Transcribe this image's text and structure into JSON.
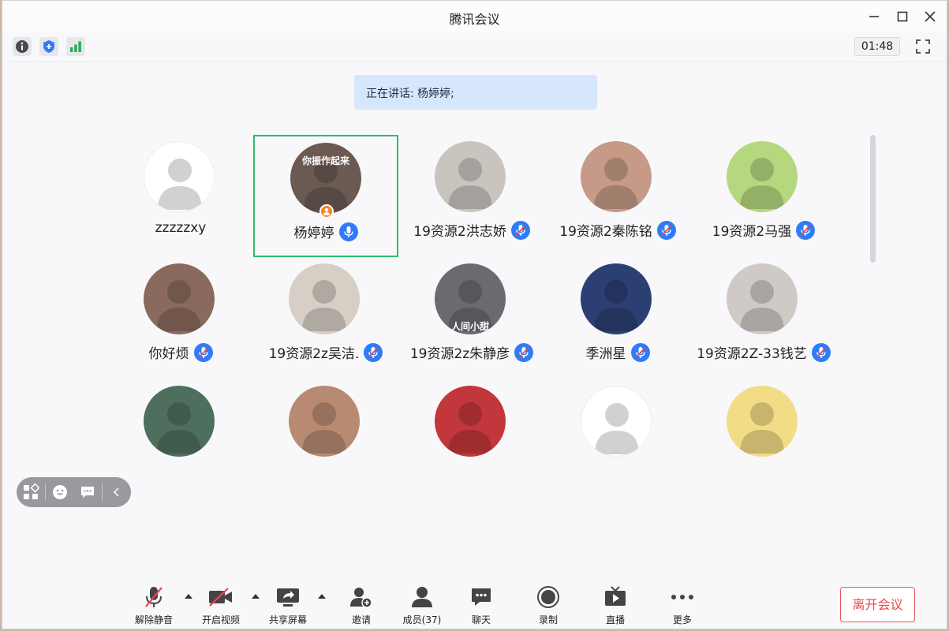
{
  "window": {
    "title": "腾讯会议"
  },
  "infobar": {
    "icons": [
      "info-icon",
      "shield-icon",
      "signal-icon"
    ],
    "timer": "01:48"
  },
  "speaking": {
    "text": "正在讲话: 杨婷婷;"
  },
  "participants": [
    {
      "name": "zzzzzxy",
      "mic": false,
      "avatar_color": "#ffffff"
    },
    {
      "name": "杨婷婷",
      "mic": true,
      "mic_active": true,
      "host": true,
      "avatar_color": "#6b5a52",
      "avatar_caption": "你振作起来"
    },
    {
      "name": "19资源2洪志娇",
      "mic": true,
      "avatar_color": "#c9c4bd"
    },
    {
      "name": "19资源2秦陈铭",
      "mic": true,
      "avatar_color": "#c69a86"
    },
    {
      "name": "19资源2马强",
      "mic": true,
      "avatar_color": "#b5d77e"
    },
    {
      "name": "你好烦",
      "mic": true,
      "avatar_color": "#8a6a5c"
    },
    {
      "name": "19资源2z吴洁.",
      "mic": true,
      "avatar_color": "#d7cfc6"
    },
    {
      "name": "19资源2z朱静彦",
      "mic": true,
      "avatar_color": "#6c6a6f",
      "avatar_caption": "人间小甜"
    },
    {
      "name": "季洲星",
      "mic": true,
      "avatar_color": "#2b3f73"
    },
    {
      "name": "19资源2Z-33钱艺",
      "mic": true,
      "avatar_color": "#cfcac6"
    },
    {
      "name": "",
      "mic": false,
      "avatar_color": "#4e6f5e"
    },
    {
      "name": "",
      "mic": false,
      "avatar_color": "#b88a72"
    },
    {
      "name": "",
      "mic": false,
      "avatar_color": "#c2373b"
    },
    {
      "name": "",
      "mic": false,
      "avatar_color": "#ffffff"
    },
    {
      "name": "",
      "mic": false,
      "avatar_color": "#f3dc86"
    }
  ],
  "floatbar": {
    "icons": [
      "layout-icon",
      "emoji-icon",
      "chat-bubble-icon",
      "collapse-icon"
    ]
  },
  "toolbar": {
    "unmute": "解除静音",
    "video": "开启视频",
    "share": "共享屏幕",
    "invite": "邀请",
    "members": "成员(37)",
    "chat": "聊天",
    "record": "录制",
    "live": "直播",
    "more": "更多"
  },
  "leave": {
    "label": "离开会议"
  },
  "colors": {
    "accent": "#2f7cf6",
    "active_border": "#2ebd6b",
    "leave": "#e8474a",
    "banner": "#d6e6fb"
  }
}
